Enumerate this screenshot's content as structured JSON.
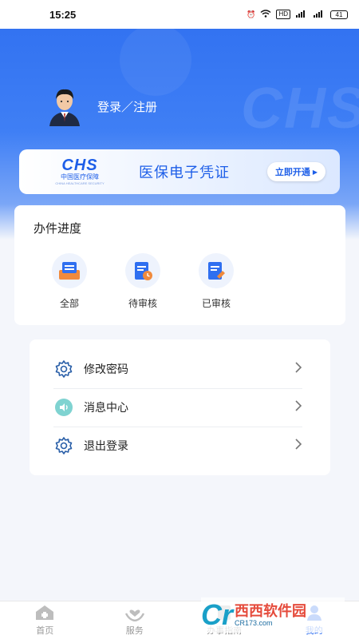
{
  "status": {
    "time": "15:25",
    "battery": "41"
  },
  "profile": {
    "login_text": "登录／注册"
  },
  "banner": {
    "logo_text": "CHS",
    "logo_cn": "中国医疗保障",
    "logo_en": "CHINA HEALTHCARE SECURITY",
    "title": "医保电子凭证",
    "button": "立即开通"
  },
  "progress": {
    "title": "办件进度",
    "items": [
      {
        "label": "全部",
        "icon": "all-docs-icon"
      },
      {
        "label": "待审核",
        "icon": "pending-review-icon"
      },
      {
        "label": "已审核",
        "icon": "reviewed-icon"
      }
    ]
  },
  "menu": {
    "items": [
      {
        "label": "修改密码",
        "icon": "gear-icon"
      },
      {
        "label": "消息中心",
        "icon": "speaker-icon"
      },
      {
        "label": "退出登录",
        "icon": "gear-icon"
      }
    ]
  },
  "tabs": [
    {
      "label": "首页",
      "icon": "home-icon"
    },
    {
      "label": "服务",
      "icon": "heart-hands-icon"
    },
    {
      "label": "办事指南",
      "icon": "guide-icon"
    },
    {
      "label": "我的",
      "icon": "user-icon"
    }
  ],
  "watermark": {
    "brand": "西西软件园",
    "site": "CR173.com"
  },
  "colors": {
    "primary": "#2f6ff0",
    "banner_blue": "#1d5ee8",
    "background": "#f4f6fb"
  }
}
